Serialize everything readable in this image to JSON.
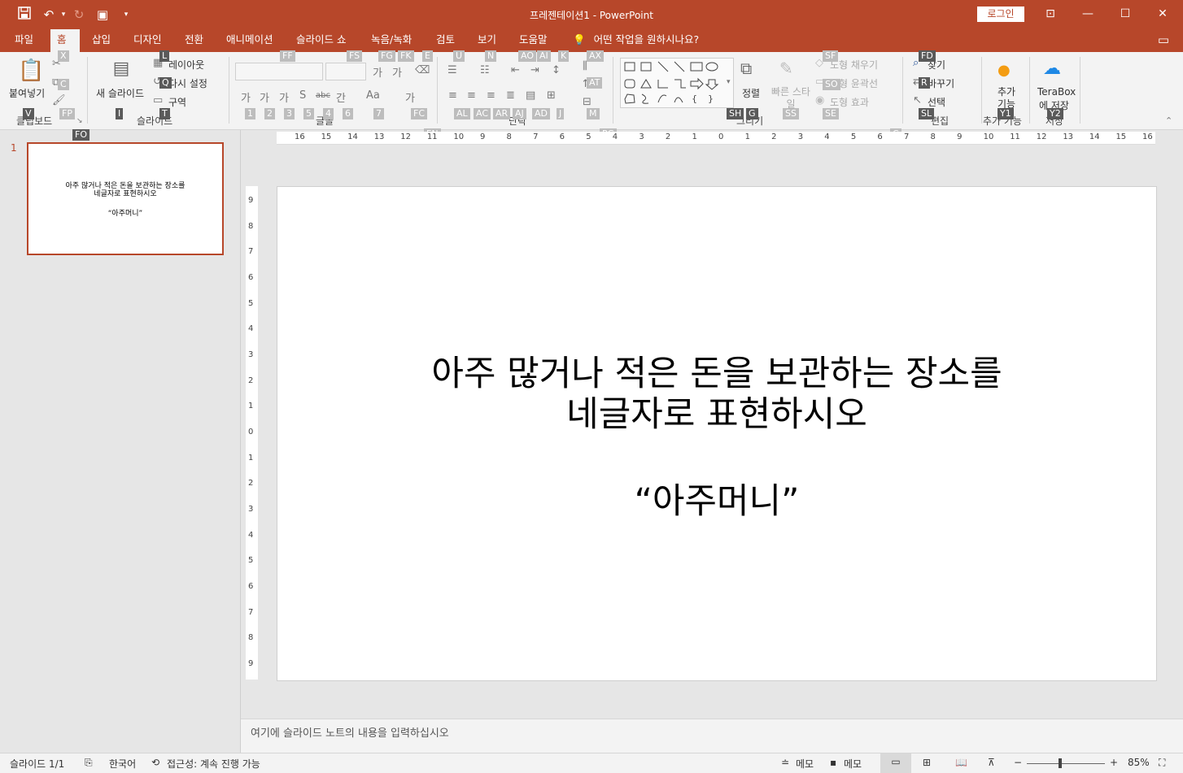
{
  "title_bar": {
    "document_title": "프레젠테이션1  -  PowerPoint",
    "login_label": "로그인",
    "quick_access": [
      "save-icon",
      "undo-icon",
      "redo-icon",
      "start-from-beginning-icon",
      "customize-icon"
    ],
    "window_controls": [
      "ribbon-display-icon",
      "minimize-icon",
      "maximize-icon",
      "close-icon"
    ]
  },
  "tabs": [
    {
      "label": "파일"
    },
    {
      "label": "홈"
    },
    {
      "label": "삽입"
    },
    {
      "label": "디자인"
    },
    {
      "label": "전환"
    },
    {
      "label": "애니메이션"
    },
    {
      "label": "슬라이드 쇼"
    },
    {
      "label": "녹음/녹화"
    },
    {
      "label": "검토"
    },
    {
      "label": "보기"
    },
    {
      "label": "도움말"
    }
  ],
  "tell_me": "어떤 작업을 원하시나요?",
  "ribbon": {
    "paste": "붙여넣기",
    "new_slide": "새 슬라이드",
    "layout": "레이아웃",
    "reset": "다시 설정",
    "section": "구역",
    "arrange": "정렬",
    "quick_styles": "빠른 스타일",
    "shape_fill": "도형 채우기",
    "shape_outline": "도형 윤곽선",
    "shape_effects": "도형 효과",
    "find": "찾기",
    "replace": "바꾸기",
    "select": "선택",
    "addins": "추가 기능",
    "terabox_line1": "TeraBox",
    "terabox_line2": "에 저장",
    "groups": {
      "clipboard": "클립보드",
      "slides": "슬라이드",
      "font": "글꼴",
      "paragraph": "단락",
      "drawing": "그리기",
      "editing": "편집",
      "addins": "추가 기능",
      "save": "저장"
    },
    "font_buttons": [
      "가",
      "가",
      "가",
      "가",
      "가",
      "S",
      "abc",
      "간",
      "Aa"
    ]
  },
  "keytips": {
    "FO": "FO",
    "X": "X",
    "C": "C",
    "FP": "FP",
    "V": "V",
    "L": "L",
    "Q": "Q",
    "I": "I",
    "T": "T",
    "FF": "FF",
    "FS": "FS",
    "FG": "FG",
    "FK": "FK",
    "E": "E",
    "k1": "1",
    "k2": "2",
    "k3": "3",
    "k5": "5",
    "k4": "4",
    "k6": "6",
    "k7": "7",
    "FC": "FC",
    "U": "U",
    "N": "N",
    "AO": "AO",
    "AI": "AI",
    "K": "K",
    "AX": "AX",
    "AT": "AT",
    "FN": "FN",
    "AL": "AL",
    "AC": "AC",
    "AR": "AR",
    "AJ": "AJ",
    "AD": "AD",
    "J": "J",
    "M": "M",
    "PG": "PG",
    "SH": "SH",
    "G": "G",
    "SS": "SS",
    "SF": "SF",
    "SO": "SO",
    "SE": "SE",
    "FD": "FD",
    "R": "R",
    "SL": "SL",
    "Y1": "Y1",
    "Y2": "Y2",
    "Cr": "C"
  },
  "slide_panel": {
    "slide_number": "1",
    "thumb_line1": "아주 많거나 적은 돈을 보관하는 장소를",
    "thumb_line2": "네글자로 표현하시오",
    "thumb_line3": "“아주머니”"
  },
  "ruler": {
    "horizontal": [
      "16",
      "15",
      "14",
      "13",
      "12",
      "11",
      "10",
      "9",
      "8",
      "7",
      "6",
      "5",
      "4",
      "3",
      "2",
      "1",
      "0",
      "1",
      "2",
      "3",
      "4",
      "5",
      "6",
      "7",
      "8",
      "9",
      "10",
      "11",
      "12",
      "13",
      "14",
      "15",
      "16"
    ],
    "vertical": [
      "9",
      "8",
      "7",
      "6",
      "5",
      "4",
      "3",
      "2",
      "1",
      "0",
      "1",
      "2",
      "3",
      "4",
      "5",
      "6",
      "7",
      "8",
      "9"
    ]
  },
  "slide": {
    "line1": "아주 많거나 적은 돈을 보관하는 장소를",
    "line2": "네글자로 표현하시오",
    "line3": "“아주머니”"
  },
  "notes_placeholder": "여기에 슬라이드 노트의 내용을 입력하십시오",
  "status_bar": {
    "slide_counter": "슬라이드 1/1",
    "language": "한국어",
    "accessibility": "접근성: 계속 진행 가능",
    "notes": "메모",
    "comments": "메모",
    "zoom_minus": "−",
    "zoom_plus": "+",
    "zoom_level": "85%"
  },
  "colors": {
    "accent": "#b7472a",
    "ribbon_bg": "#f3f3f3",
    "canvas_bg": "#e6e6e6"
  }
}
